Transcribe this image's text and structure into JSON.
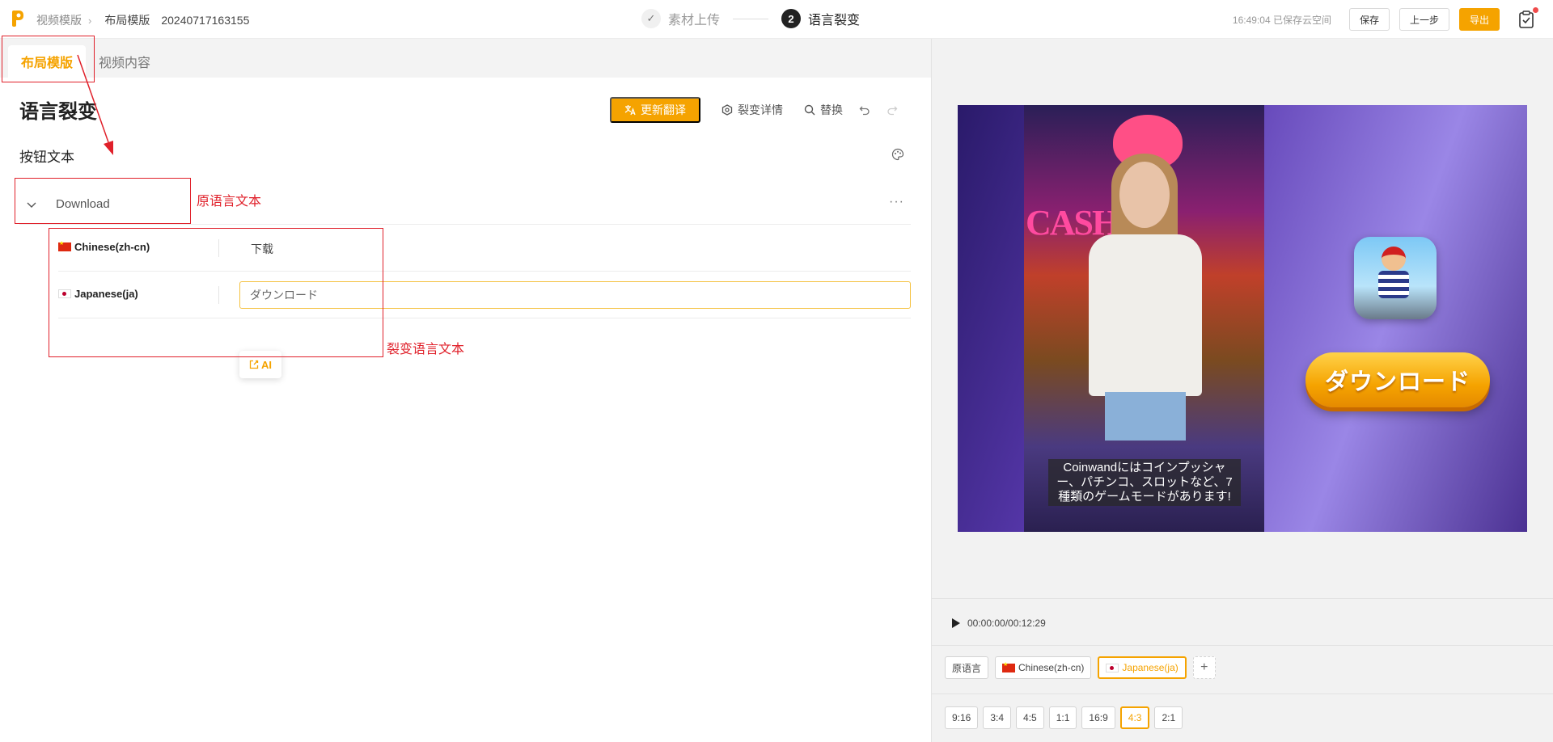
{
  "header": {
    "breadcrumb_root": "视频模版",
    "breadcrumb_current": "布局模版",
    "project_name": "20240717163155",
    "steps": [
      {
        "number": "✓",
        "label": "素材上传",
        "state": "done"
      },
      {
        "number": "2",
        "label": "语言裂变",
        "state": "active"
      }
    ],
    "saved_status": "16:49:04 已保存云空间",
    "save_label": "保存",
    "prev_label": "上一步",
    "export_label": "导出"
  },
  "tabs": {
    "layout": "布局模版",
    "video": "视频内容"
  },
  "main": {
    "title": "语言裂变",
    "translate_label": "更新翻译",
    "details_label": "裂变详情",
    "replace_label": "替换",
    "section_label": "按钮文本",
    "source_text": "Download",
    "more": "···",
    "languages": [
      {
        "name": "Chinese(zh-cn)",
        "text": "下载"
      },
      {
        "name": "Japanese(ja)",
        "text": "ダウンロード"
      }
    ],
    "ai_label": "AI"
  },
  "annotations": {
    "source_label": "原语言文本",
    "target_label": "裂变语言文本"
  },
  "preview": {
    "cta_text": "ダウンロード",
    "subtitle": "Coinwandにはコインプッシャー、パチンコ、スロットなど、7種類のゲームモードがあります!",
    "cash_sign": "CASH  GY"
  },
  "player": {
    "time": "00:00:00/00:12:29"
  },
  "language_chips": [
    {
      "label": "原语言",
      "flag": "",
      "active": false
    },
    {
      "label": "Chinese(zh-cn)",
      "flag": "cn",
      "active": false
    },
    {
      "label": "Japanese(ja)",
      "flag": "jp",
      "active": true
    }
  ],
  "add_label": "+",
  "ratios": [
    {
      "label": "9:16",
      "active": false
    },
    {
      "label": "3:4",
      "active": false
    },
    {
      "label": "4:5",
      "active": false
    },
    {
      "label": "1:1",
      "active": false
    },
    {
      "label": "16:9",
      "active": false
    },
    {
      "label": "4:3",
      "active": true
    },
    {
      "label": "2:1",
      "active": false
    }
  ],
  "colors": {
    "accent": "#f5a300",
    "annotation": "#e0202a"
  }
}
